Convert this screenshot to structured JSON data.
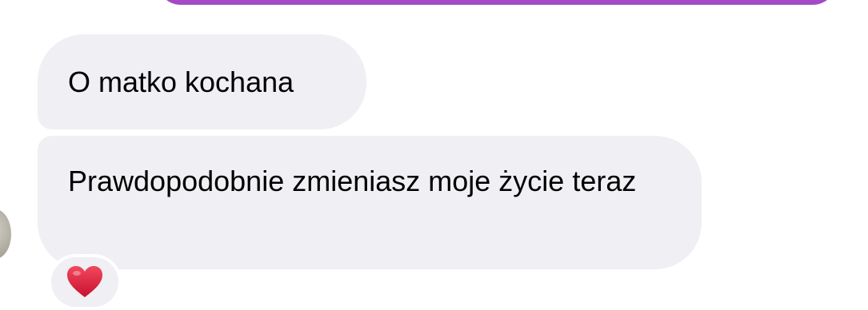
{
  "colors": {
    "outgoing_bubble": "#a44ac6",
    "incoming_bubble": "#efeff4",
    "reaction_heart": "#e5243b"
  },
  "messages": [
    {
      "text": "O matko kochana"
    },
    {
      "text": "Prawdopodobnie zmieniasz moje życie teraz"
    }
  ],
  "reaction": {
    "icon": "red-heart-icon"
  }
}
